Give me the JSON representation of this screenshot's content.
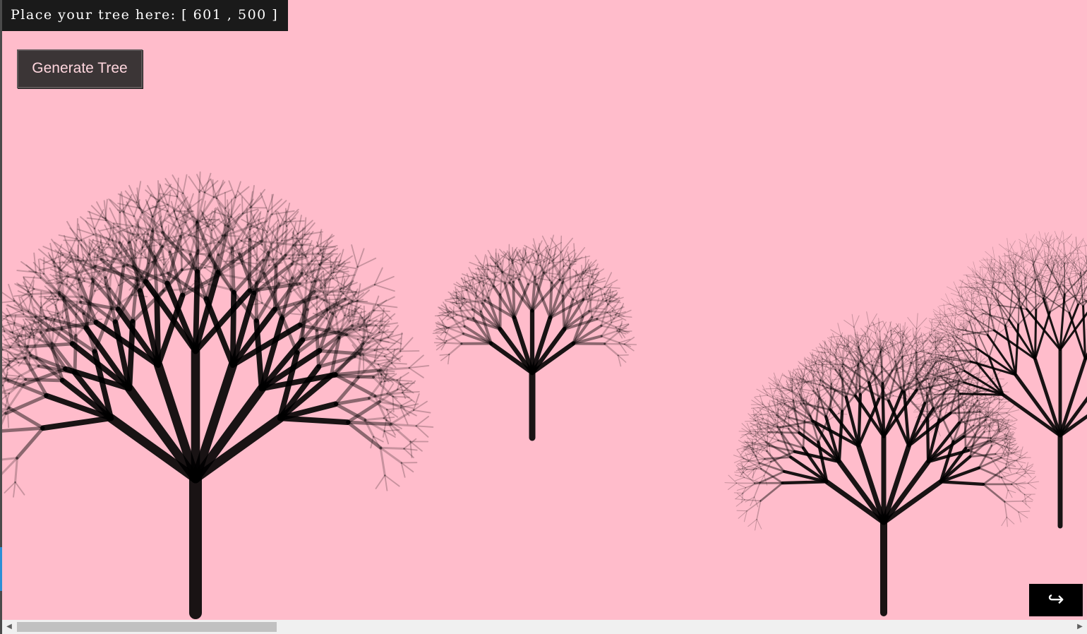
{
  "banner": {
    "text": "Place your tree here: [ 601 , 500 ]"
  },
  "controls": {
    "generate_label": "Generate Tree",
    "redo_glyph": "↪"
  },
  "scene": {
    "background_color": "#ffbccb",
    "tree_color": "#000000"
  },
  "scrollbar": {
    "left_arrow": "◀",
    "right_arrow": "▶"
  }
}
